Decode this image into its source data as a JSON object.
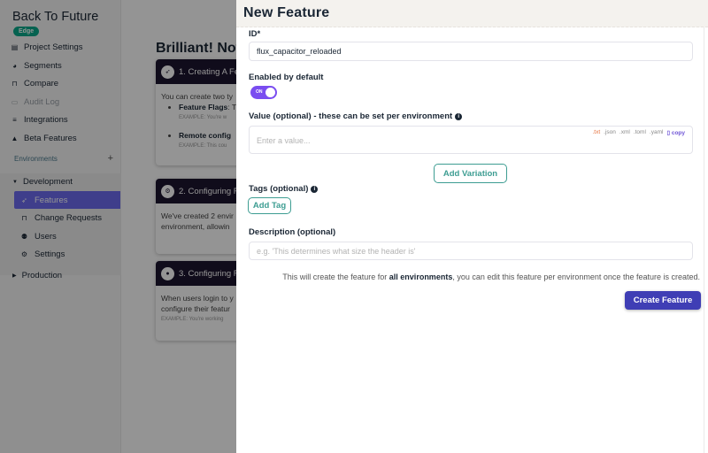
{
  "sidebar": {
    "project_title": "Back To Future",
    "badge": "Edge",
    "items": [
      {
        "label": "Project Settings",
        "icon": "project-settings-icon",
        "glyph": "▤"
      },
      {
        "label": "Segments",
        "icon": "pie-chart-icon",
        "glyph": "◕"
      },
      {
        "label": "Compare",
        "icon": "compare-icon",
        "glyph": "⊓"
      },
      {
        "label": "Audit Log",
        "icon": "audit-log-icon",
        "glyph": "▭"
      },
      {
        "label": "Integrations",
        "icon": "integrations-icon",
        "glyph": "≡"
      },
      {
        "label": "Beta Features",
        "icon": "flask-icon",
        "glyph": "▲"
      }
    ],
    "environments_label": "Environments",
    "add_env": "+",
    "environments": [
      {
        "name": "Development",
        "expanded": true,
        "children": [
          {
            "label": "Features",
            "icon": "rocket-icon",
            "glyph": "🚀",
            "active": true
          },
          {
            "label": "Change Requests",
            "icon": "change-request-icon",
            "glyph": "⊓"
          },
          {
            "label": "Users",
            "icon": "users-icon",
            "glyph": "👥"
          },
          {
            "label": "Settings",
            "icon": "gears-icon",
            "glyph": "⚙"
          }
        ]
      },
      {
        "name": "Production",
        "expanded": false
      }
    ]
  },
  "main": {
    "heading": "Brilliant! Now",
    "cards": [
      {
        "title": "1. Creating A Fe",
        "glyph": "🚀",
        "lines": [
          "You can create two ty"
        ],
        "bullets": [
          {
            "bold": "Feature Flags",
            "rest": ": T",
            "example": "EXAMPLE: You're w"
          },
          {
            "bold": "Remote config",
            "rest": "",
            "example": "EXAMPLE: This cou"
          }
        ]
      },
      {
        "title": "2. Configuring F",
        "glyph": "⚙",
        "lines": [
          "We've created 2 envir",
          "environment, allowin"
        ]
      },
      {
        "title": "3. Configuring F",
        "glyph": "👤",
        "lines": [
          "When users login to y",
          "configure their featur"
        ],
        "example": "EXAMPLE: You're working"
      }
    ]
  },
  "modal": {
    "title": "New Feature",
    "id_label": "ID*",
    "id_value": "flux_capacitor_reloaded",
    "enabled_label": "Enabled by default",
    "toggle_text": "ON",
    "toggle_state": true,
    "value_label": "Value (optional) - these can be set per environment",
    "value_placeholder": "Enter a value...",
    "formats": [
      ".txt",
      ".json",
      ".xml",
      ".toml",
      ".yaml"
    ],
    "copy_label": "copy",
    "add_variation": "Add Variation",
    "tags_label": "Tags (optional)",
    "add_tag": "Add Tag",
    "description_label": "Description (optional)",
    "description_placeholder": "e.g. 'This determines what size the header is'",
    "note_prefix": "This will create the feature for ",
    "note_bold": "all environments",
    "note_suffix": ", you can edit this feature per environment once the feature is created.",
    "create_button": "Create Feature"
  },
  "colors": {
    "accent": "#6d6cf0",
    "primary_button": "#3f3eb5",
    "outline_button": "#3d9d92",
    "toggle": "#7a4df0",
    "badge": "#0aaa8a"
  }
}
